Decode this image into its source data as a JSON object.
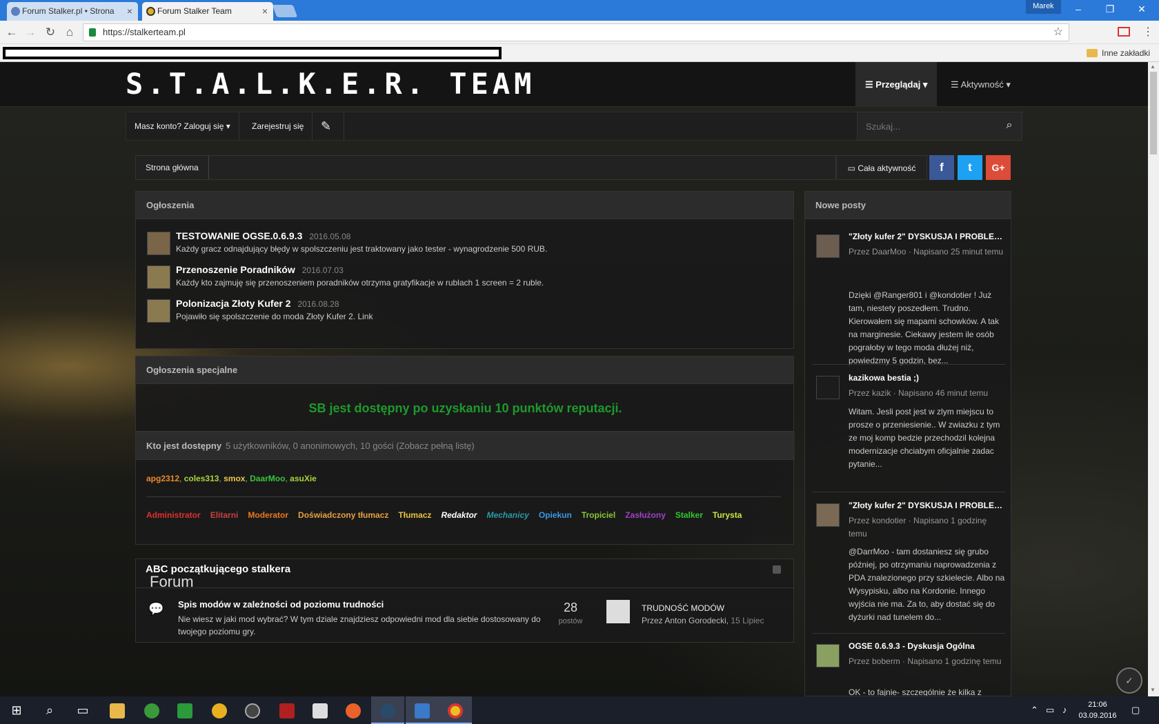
{
  "browser": {
    "tabs": [
      {
        "label": "Forum Stalker.pl • Strona",
        "close": "×"
      },
      {
        "label": "Forum Stalker Team",
        "close": "×"
      }
    ],
    "user_chip": "Marek",
    "window_controls": {
      "minimize": "–",
      "maximize": "❐",
      "close": "✕"
    },
    "nav": {
      "back": "←",
      "forward": "→",
      "reload": "↻",
      "home": "⌂"
    },
    "url": "https://stalkerteam.pl",
    "bookmark_folder": "Inne zakładki"
  },
  "site": {
    "logo": "S.T.A.L.K.E.R. TEAM",
    "nav": {
      "browse": "Przeglądaj",
      "activity": "Aktywność"
    },
    "userbar": {
      "login": "Masz konto? Zaloguj się",
      "register": "Zarejestruj się"
    },
    "search_placeholder": "Szukaj...",
    "breadcrumb_home": "Strona główna",
    "all_activity": "Cała aktywność",
    "social": {
      "facebook": "f",
      "twitter": "t",
      "google": "G+"
    }
  },
  "announcements": {
    "title": "Ogłoszenia",
    "items": [
      {
        "title": "TESTOWANIE OGSE.0.6.9.3",
        "date": "2016.05.08",
        "desc": "Każdy gracz odnajdujący błędy w spolszczeniu jest traktowany jako tester - wynagrodzenie 500 RUB."
      },
      {
        "title": "Przenoszenie Poradników",
        "date": "2016.07.03",
        "desc": "Każdy kto zajmuję się przenoszeniem poradników otrzyma gratyfikacje w rublach 1 screen = 2 ruble."
      },
      {
        "title": "Polonizacja Złoty Kufer 2",
        "date": "2016.08.28",
        "desc": "Pojawiło się spolszczenie do moda Złoty Kufer 2. Link"
      }
    ]
  },
  "special": {
    "title": "Ogłoszenia specjalne",
    "message": "SB jest dostępny po uzyskaniu 10 punktów reputacji."
  },
  "online": {
    "title": "Kto jest dostępny",
    "summary": "5 użytkowników, 0 anonimowych, 10 gości (Zobacz pełną listę)",
    "users": [
      {
        "name": "apg2312",
        "color": "#e8892a"
      },
      {
        "name": "coles313",
        "color": "#a8d63a"
      },
      {
        "name": "smox",
        "color": "#e8c84a"
      },
      {
        "name": "DaarMoo",
        "color": "#3ac43a"
      },
      {
        "name": "asuXie",
        "color": "#a8d63a"
      }
    ],
    "groups": [
      {
        "name": "Administrator",
        "color": "#e03030"
      },
      {
        "name": "Elitarni",
        "color": "#c84040"
      },
      {
        "name": "Moderator",
        "color": "#e87a20"
      },
      {
        "name": "Doświadczony tłumacz",
        "color": "#e8a040"
      },
      {
        "name": "Tłumacz",
        "color": "#e8c040"
      },
      {
        "name": "Redaktor",
        "color": "#ffffff"
      },
      {
        "name": "Mechanicy",
        "color": "#2a9aa8"
      },
      {
        "name": "Opiekun",
        "color": "#3a9ae8"
      },
      {
        "name": "Tropiciel",
        "color": "#8ac830"
      },
      {
        "name": "Zasłużony",
        "color": "#a040c8"
      },
      {
        "name": "Stalker",
        "color": "#30c830"
      },
      {
        "name": "Turysta",
        "color": "#c8e840"
      }
    ]
  },
  "forum": {
    "title": "Forum",
    "category": "ABC początkującego stalkera",
    "row": {
      "name": "Spis modów w zależności od poziomu trudności",
      "desc": "Nie wiesz w jaki mod wybrać? W tym dziale znajdziesz odpowiedni mod dla siebie dostosowany do twojego poziomu gry.",
      "count": "28",
      "count_label": "postów",
      "last_title": "TRUDNOŚĆ MODÓW",
      "last_by": "Przez Anton Gorodecki,",
      "last_date": "15 Lipiec"
    }
  },
  "new_posts": {
    "title": "Nowe posty",
    "items": [
      {
        "title": "\"Złoty kufer 2\" DYSKUSJA I PROBLEMY",
        "meta": "Przez DaarMoo · Napisano 25 minut temu",
        "body": "Dzięki @Ranger801 i @kondotier ! Już tam, niestety poszedłem. Trudno. Kierowałem się mapami schowków. A tak na marginesie. Ciekawy jestem ile osób pograłoby w tego moda dłużej niż, powiedzmy 5 godzin, bez...",
        "avatar": "#6b5e50"
      },
      {
        "title": "kazikowa bestia ;)",
        "meta": "Przez kazik · Napisano 46 minut temu",
        "body": "Witam. Jesli post jest w zlym miejscu to prosze o przeniesienie.. W zwiazku z tym ze moj komp bedzie przechodzil kolejna modernizacje chciabym oficjalnie zadac pytanie...",
        "avatar": "#1c1c1c"
      },
      {
        "title": "\"Złoty kufer 2\" DYSKUSJA I PROBLEMY",
        "meta": "Przez kondotier · Napisano 1 godzinę temu",
        "body": "@DarrMoo - tam dostaniesz się grubo później, po otrzymaniu naprowadzenia z PDA znalezionego przy szkielecie. Albo na Wysypisku, albo na Kordonie. Innego wyjścia nie ma. Za to, aby dostać się do dyżurki nad tunelem do...",
        "avatar": "#7a6a55"
      },
      {
        "title": "OGSE 0.6.9.3 - Dyskusja Ogólna",
        "meta": "Przez boberm · Napisano 1 godzinę temu",
        "body": "OK - to fajnie- szczególnie że kilka z",
        "avatar": "#8aa060"
      }
    ]
  },
  "taskbar": {
    "clock_time": "21:06",
    "clock_date": "03.09.2016",
    "icons": [
      "windows-start",
      "search",
      "task-view",
      "file-explorer",
      "utorrent",
      "sixtyfour",
      "app-yellow",
      "app-dark",
      "app-red",
      "video-editor",
      "app-orange",
      "steam",
      "uplay",
      "chrome"
    ]
  }
}
